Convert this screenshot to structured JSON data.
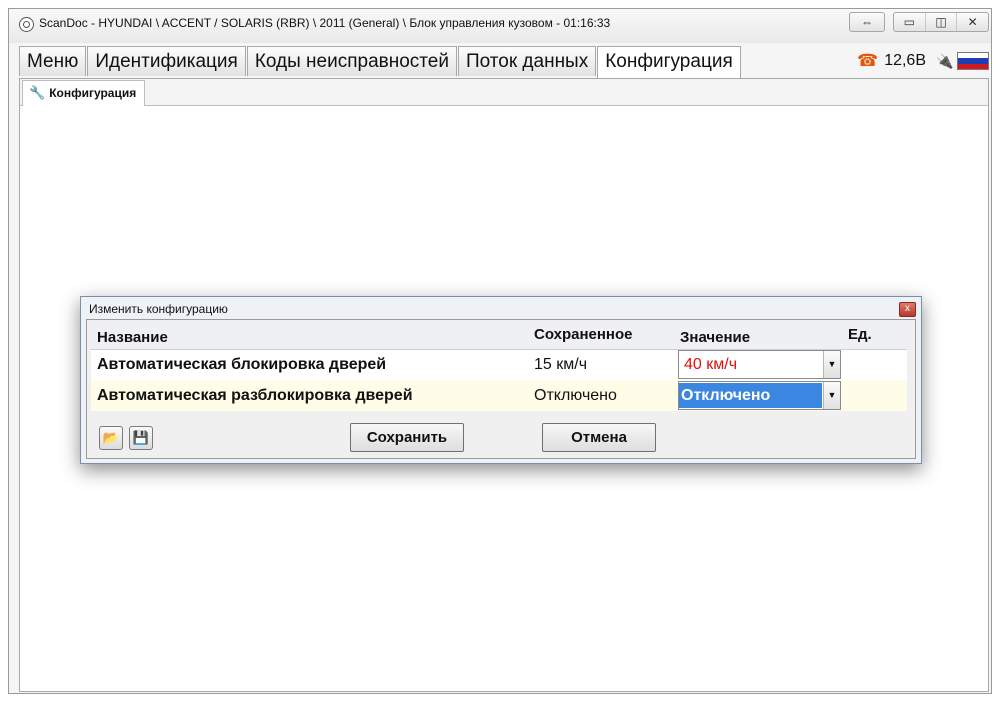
{
  "window": {
    "title": "ScanDoc - HYUNDAI \\ ACCENT / SOLARIS (RBR) \\ 2011 (General) \\ Блок управления кузовом - 01:16:33",
    "controls": {
      "resize": "⇔",
      "minimize": "▭",
      "maximize": "◫",
      "close": "✕"
    }
  },
  "tabs": [
    {
      "label": "Меню"
    },
    {
      "label": "Идентификация"
    },
    {
      "label": "Коды неисправностей"
    },
    {
      "label": "Поток данных"
    },
    {
      "label": "Конфигурация",
      "active": true
    }
  ],
  "status": {
    "voltage": "12,6В",
    "phone_icon": "☎",
    "plug_icon": "🔌"
  },
  "subtab": {
    "label": "Конфигурация",
    "icon": "🔧"
  },
  "dialog": {
    "title": "Изменить конфигурацию",
    "close": "x",
    "columns": {
      "name": "Название",
      "saved": "Сохраненное",
      "value": "Значение",
      "unit": "Ед."
    },
    "rows": [
      {
        "name": "Автоматическая блокировка дверей",
        "saved": "15 км/ч",
        "value": "40 км/ч",
        "unit": ""
      },
      {
        "name": "Автоматическая разблокировка дверей",
        "saved": "Отключено",
        "value": "Отключено",
        "unit": ""
      }
    ],
    "buttons": {
      "save": "Сохранить",
      "cancel": "Отмена",
      "open_icon": "📂",
      "save_icon": "💾"
    }
  },
  "colors": {
    "changed_value": "#e01010",
    "selection_bg": "#3a86e0",
    "selected_row_bg": "#fffde8",
    "flag": [
      "#ffffff",
      "#1c3fb6",
      "#d0191f"
    ]
  }
}
